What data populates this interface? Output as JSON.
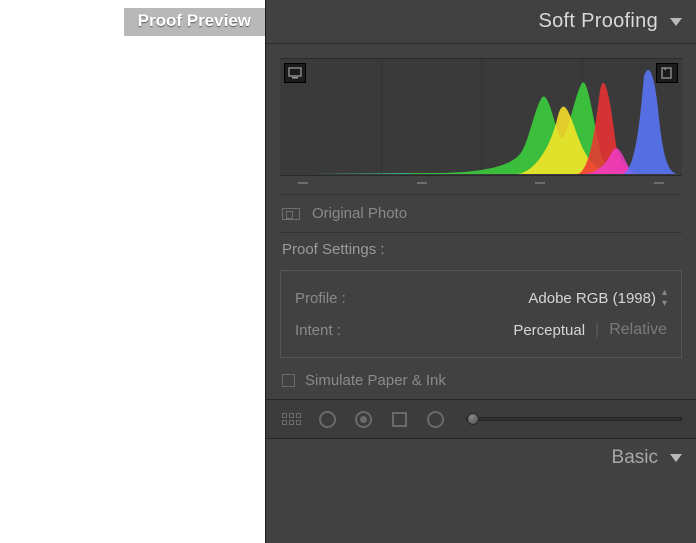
{
  "badge": "Proof Preview",
  "panel_title": "Soft Proofing",
  "original_photo": "Original Photo",
  "proof_settings_label": "Proof Settings :",
  "profile": {
    "label": "Profile :",
    "value": "Adobe RGB (1998)"
  },
  "intent": {
    "label": "Intent :",
    "selected": "Perceptual",
    "other": "Relative"
  },
  "simulate_label": "Simulate Paper & Ink",
  "basic_title": "Basic"
}
